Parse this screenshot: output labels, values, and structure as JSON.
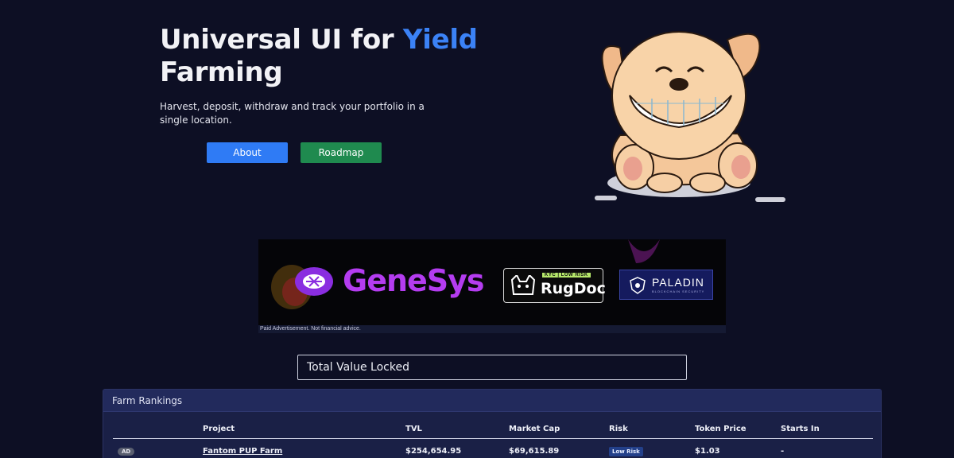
{
  "hero": {
    "title_line1": "Universal UI for ",
    "title_accent": "Yield",
    "title_line2": "Farming",
    "subtitle": "Harvest, deposit, withdraw and track your portfolio in a single location.",
    "about_label": "About",
    "roadmap_label": "Roadmap"
  },
  "ad": {
    "brands": [
      "GeneSys",
      "RugDoc",
      "PALADIN"
    ],
    "rugdoc_tag": "KYC | LOW RISK",
    "paladin_sub": "BLOCKCHAIN SECURITY",
    "disclaimer": "Paid Advertisement. Not financial advice."
  },
  "tvl": {
    "label": "Total Value Locked"
  },
  "rankings": {
    "title": "Farm Rankings",
    "columns": [
      "Project",
      "TVL",
      "Market Cap",
      "Risk",
      "Token Price",
      "Starts In"
    ],
    "rows": [
      {
        "badge": "AD",
        "project": "Fantom PUP Farm",
        "tvl": "$254,654.95",
        "market_cap": "$69,615.89",
        "risk": "Low Risk",
        "token_price": "$1.03",
        "starts_in": "-"
      }
    ]
  },
  "colors": {
    "background": "#0d0f24",
    "accent": "#3b82f6",
    "about_button": "#2f7bf5",
    "roadmap_button": "#1f8a4f",
    "panel": "#1a2046"
  },
  "icons": [
    "dog-mascot-icon",
    "genesys-logo-icon",
    "rugdoc-cat-icon",
    "paladin-shield-icon"
  ]
}
